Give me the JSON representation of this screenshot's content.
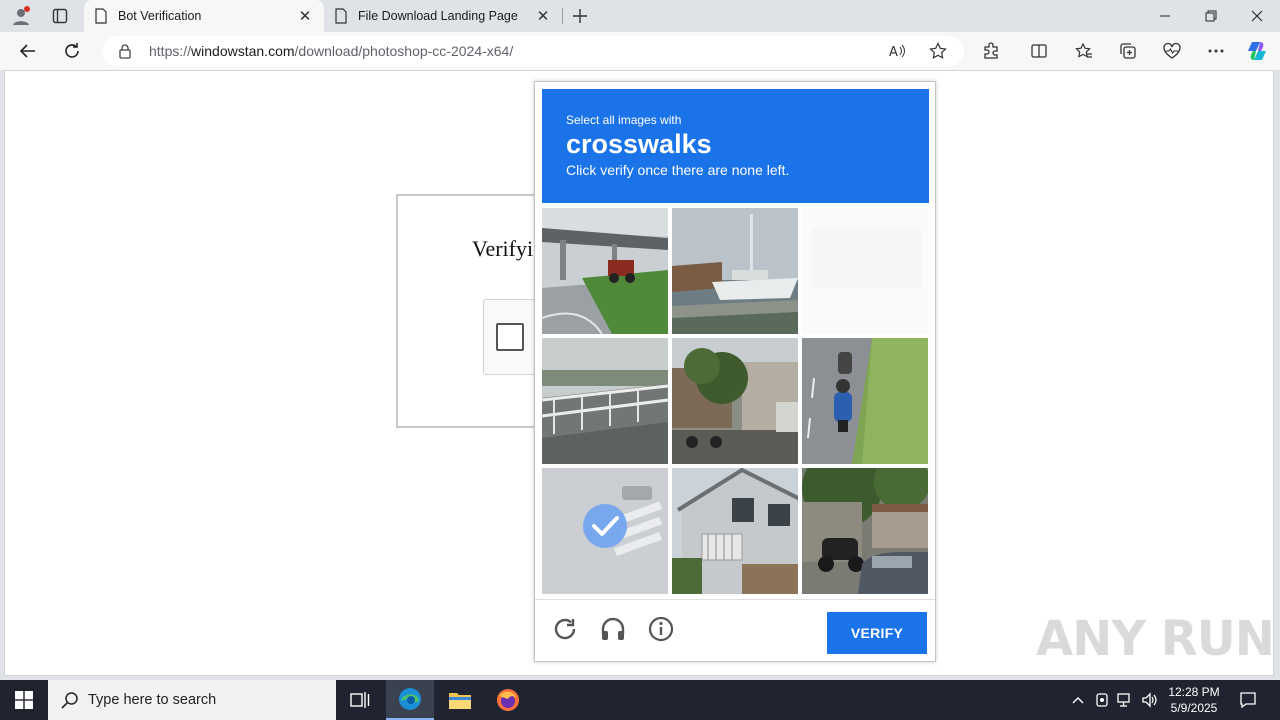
{
  "browser": {
    "tabs": [
      {
        "title": "Bot Verification",
        "active": true
      },
      {
        "title": "File Download Landing Page",
        "active": false
      }
    ],
    "address": {
      "url_domain": "windowstan.com",
      "url_prefix": "https://",
      "url_path": "/download/photoshop-cc-2024-x64/"
    }
  },
  "page": {
    "verify_heading": "Verifyi",
    "captcha": {
      "instruction": "Select all images with",
      "target": "crosswalks",
      "hint": "Click verify once there are none left.",
      "verify_label": "VERIFY",
      "tiles": [
        {
          "content": "road-overpass-tractor",
          "selected": false
        },
        {
          "content": "boats-harbor",
          "selected": false
        },
        {
          "content": "blank-fading",
          "selected": false
        },
        {
          "content": "bridge-railing",
          "selected": false
        },
        {
          "content": "street-trees-shops",
          "selected": false
        },
        {
          "content": "motorcyclist-road",
          "selected": false
        },
        {
          "content": "crosswalk-intersection",
          "selected": true
        },
        {
          "content": "house-balcony",
          "selected": false
        },
        {
          "content": "motorbike-car-street",
          "selected": false
        }
      ]
    }
  },
  "watermark": "ANY RUN",
  "taskbar": {
    "search_placeholder": "Type here to search",
    "time": "12:28 PM",
    "date": "5/9/2025"
  },
  "colors": {
    "accent": "#1a73e8",
    "taskbar": "#1f2430"
  }
}
